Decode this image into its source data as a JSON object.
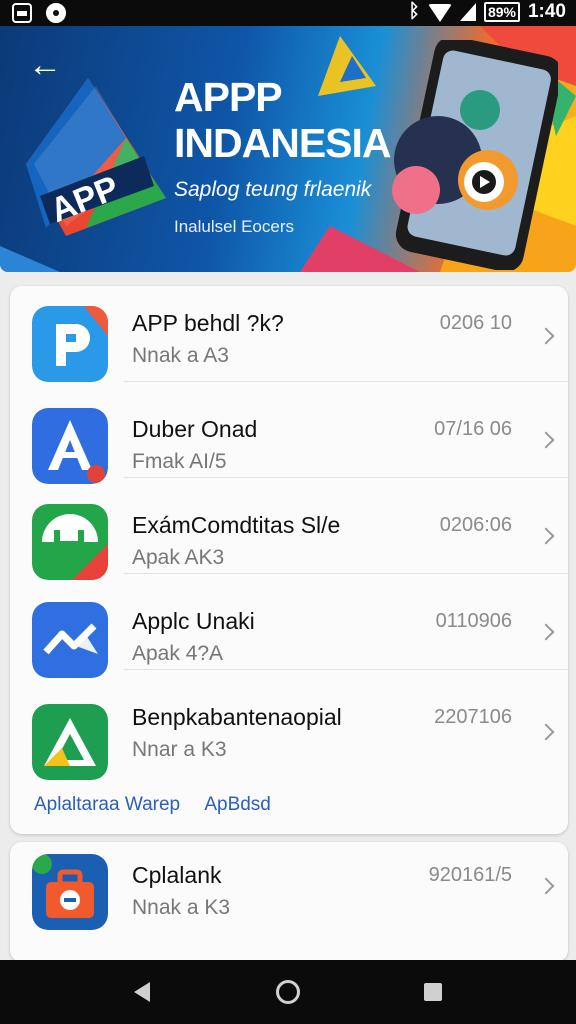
{
  "status_bar": {
    "battery": "89%",
    "time": "1:40"
  },
  "banner": {
    "title_line1": "APPP",
    "title_line2": "INDANESIA",
    "subtitle": "Saplog teung frlaenik",
    "small_text": "Inalulsel Eocers",
    "logo_text": "APP"
  },
  "list": {
    "items": [
      {
        "title": "APP behdl ?k?",
        "subtitle": "Nnak a A3",
        "number": "0206 10"
      },
      {
        "title": "Duber Onad",
        "subtitle": "Fmak AI/5",
        "number": "07/16 06"
      },
      {
        "title": "ExámComdtitas Sl/e",
        "subtitle": "Apak AK3",
        "number": "0206:06"
      },
      {
        "title": "Applc Unaki",
        "subtitle": "Apak 4?A",
        "number": "0110906"
      },
      {
        "title": "Benpkabantenaopial",
        "subtitle": "Nnar a K3",
        "number": "2207106"
      }
    ],
    "footer_link1": "Aplaltaraa Warep",
    "footer_link2": "ApBdsd"
  },
  "second_card": {
    "title": "Cplalank",
    "subtitle": "Nnak a K3",
    "number": "920161/5"
  },
  "colors": {
    "accent": "#2c5fb6",
    "banner_dark": "#0c3a78",
    "banner_orange": "#f26b2c"
  }
}
